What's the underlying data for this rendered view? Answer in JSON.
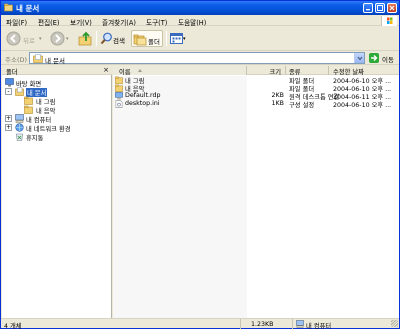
{
  "window": {
    "title": "내 문서"
  },
  "menu": [
    "파일(F)",
    "편집(E)",
    "보기(V)",
    "즐겨찾기(A)",
    "도구(T)",
    "도움말(H)"
  ],
  "toolbar": {
    "back_label": "뒤로",
    "search_label": "검색",
    "folders_label": "폴더"
  },
  "address": {
    "label": "주소(D)",
    "value": "내 문서",
    "go_label": "이동"
  },
  "folders_pane": {
    "title": "폴더",
    "close_glyph": "×",
    "tree": [
      {
        "label": "바탕 화면",
        "icon": "desktop-icon"
      },
      {
        "label": "내 문서",
        "icon": "my-documents-icon",
        "selected": true,
        "expander": "-"
      },
      {
        "label": "내 그림",
        "icon": "folder-icon"
      },
      {
        "label": "내 음악",
        "icon": "folder-icon"
      },
      {
        "label": "내 컴퓨터",
        "icon": "my-computer-icon",
        "expander": "+"
      },
      {
        "label": "내 네트워크 환경",
        "icon": "network-icon",
        "expander": "+"
      },
      {
        "label": "휴지통",
        "icon": "recycle-bin-icon"
      }
    ]
  },
  "columns": {
    "name": "이름",
    "size": "크기",
    "type": "종류",
    "modified": "수정한 날짜"
  },
  "files": [
    {
      "name": "내 그림",
      "size": "",
      "type": "파일 폴더",
      "modified": "2004-06-10 오후 ...",
      "icon": "folder-icon"
    },
    {
      "name": "내 음악",
      "size": "",
      "type": "파일 폴더",
      "modified": "2004-06-10 오후 ...",
      "icon": "folder-icon"
    },
    {
      "name": "Default.rdp",
      "size": "2KB",
      "type": "원격 데스크톱 연결",
      "modified": "2004-06-11 오후 ...",
      "icon": "rdp-file-icon"
    },
    {
      "name": "desktop.ini",
      "size": "1KB",
      "type": "구성 설정",
      "modified": "2004-06-10 오후 ...",
      "icon": "ini-file-icon"
    }
  ],
  "status": {
    "count": "4 개체",
    "size": "1.23KB",
    "location": "내 컴퓨터"
  },
  "colors": {
    "title_bar": "#0a5de8",
    "selection": "#316ac5",
    "folder": "#f2d173",
    "go": "#2da93a"
  }
}
